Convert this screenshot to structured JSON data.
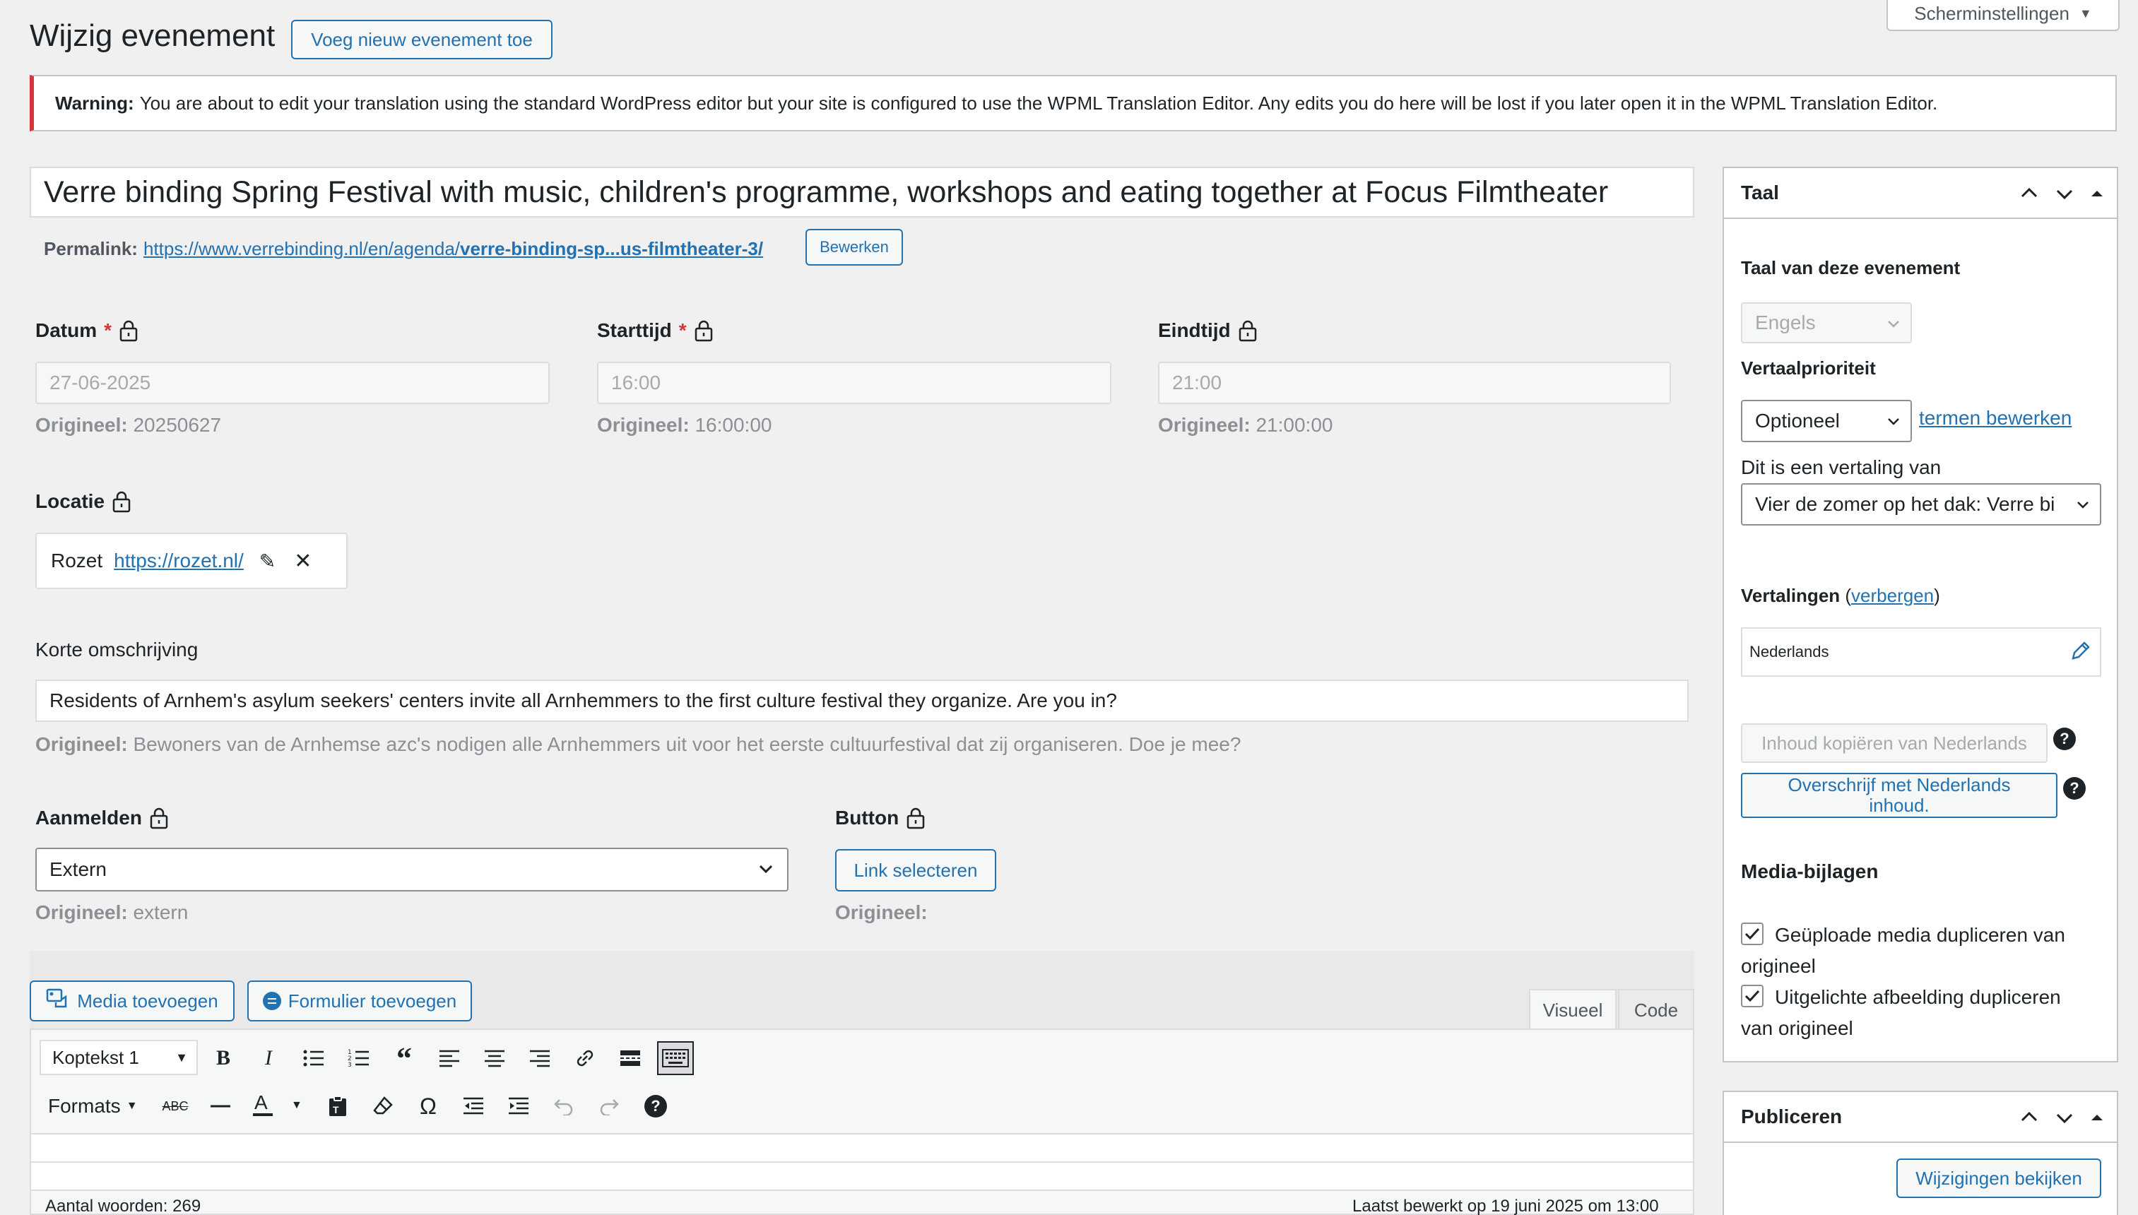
{
  "header": {
    "title": "Wijzig evenement",
    "add_new_label": "Voeg nieuw evenement toe",
    "screen_options_label": "Scherminstellingen"
  },
  "warning": {
    "prefix": "Warning:",
    "text": "You are about to edit your translation using the standard WordPress editor but your site is configured to use the WPML Translation Editor. Any edits you do here will be lost if you later open it in the WPML Translation Editor."
  },
  "post": {
    "title": "Verre binding Spring Festival with music, children's programme, workshops and eating together at Focus Filmtheater",
    "permalink_label": "Permalink:",
    "permalink_base": "https://www.verrebinding.nl/en/agenda/",
    "permalink_slug": "verre-binding-sp...us-filmtheater-3/",
    "permalink_edit_label": "Bewerken"
  },
  "fields": {
    "datum": {
      "label": "Datum",
      "value": "27-06-2025",
      "original_label": "Origineel:",
      "original_value": "20250627"
    },
    "starttijd": {
      "label": "Starttijd",
      "value": "16:00",
      "original_label": "Origineel:",
      "original_value": "16:00:00"
    },
    "eindtijd": {
      "label": "Eindtijd",
      "value": "21:00",
      "original_label": "Origineel:",
      "original_value": "21:00:00"
    },
    "locatie": {
      "label": "Locatie",
      "name": "Rozet",
      "url": "https://rozet.nl/"
    },
    "korte": {
      "label": "Korte omschrijving",
      "value": "Residents of Arnhem's asylum seekers' centers invite all Arnhemmers to the first culture festival they organize. Are you in?",
      "original_label": "Origineel:",
      "original_value": "Bewoners van de Arnhemse azc's nodigen alle Arnhemmers uit voor het eerste cultuurfestival dat zij organiseren. Doe je mee?"
    },
    "aanmelden": {
      "label": "Aanmelden",
      "value": "Extern",
      "original_label": "Origineel:",
      "original_value": "extern"
    },
    "button": {
      "label": "Button",
      "link_label": "Link selecteren",
      "original_label": "Origineel:"
    },
    "required_mark": "*"
  },
  "editor": {
    "media_label": "Media toevoegen",
    "form_label": "Formulier toevoegen",
    "tab_visual": "Visueel",
    "tab_code": "Code",
    "format_select": "Koptekst 1",
    "formats_label": "Formats",
    "word_count": "Aantal woorden: 269",
    "last_edited": "Laatst bewerkt op 19 juni 2025 om 13:00"
  },
  "language_panel": {
    "title": "Taal",
    "lang_label": "Taal van deze evenement",
    "lang_value": "Engels",
    "priority_label": "Vertaalprioriteit",
    "priority_value": "Optioneel",
    "terms_link": "termen bewerken",
    "translation_of_label": "Dit is een vertaling van",
    "translation_of_value": "Vier de zomer op het dak: Verre bi",
    "translations_label": "Vertalingen",
    "hide_link": "verbergen",
    "translation_lang": "Nederlands",
    "copy_button": "Inhoud kopiëren van Nederlands",
    "overwrite_line1": "Overschrijf met Nederlands",
    "overwrite_line2": "inhoud.",
    "media_title": "Media-bijlagen",
    "dup_media_line1": "Geüploade media dupliceren van",
    "dup_media_line2": "origineel",
    "dup_featured_line1": "Uitgelichte afbeelding dupliceren",
    "dup_featured_line2": "van origineel"
  },
  "publish_panel": {
    "title": "Publiceren",
    "preview_label": "Wijzigingen bekijken"
  },
  "colors": {
    "accent": "#2271b1",
    "warning_border": "#d63638"
  }
}
